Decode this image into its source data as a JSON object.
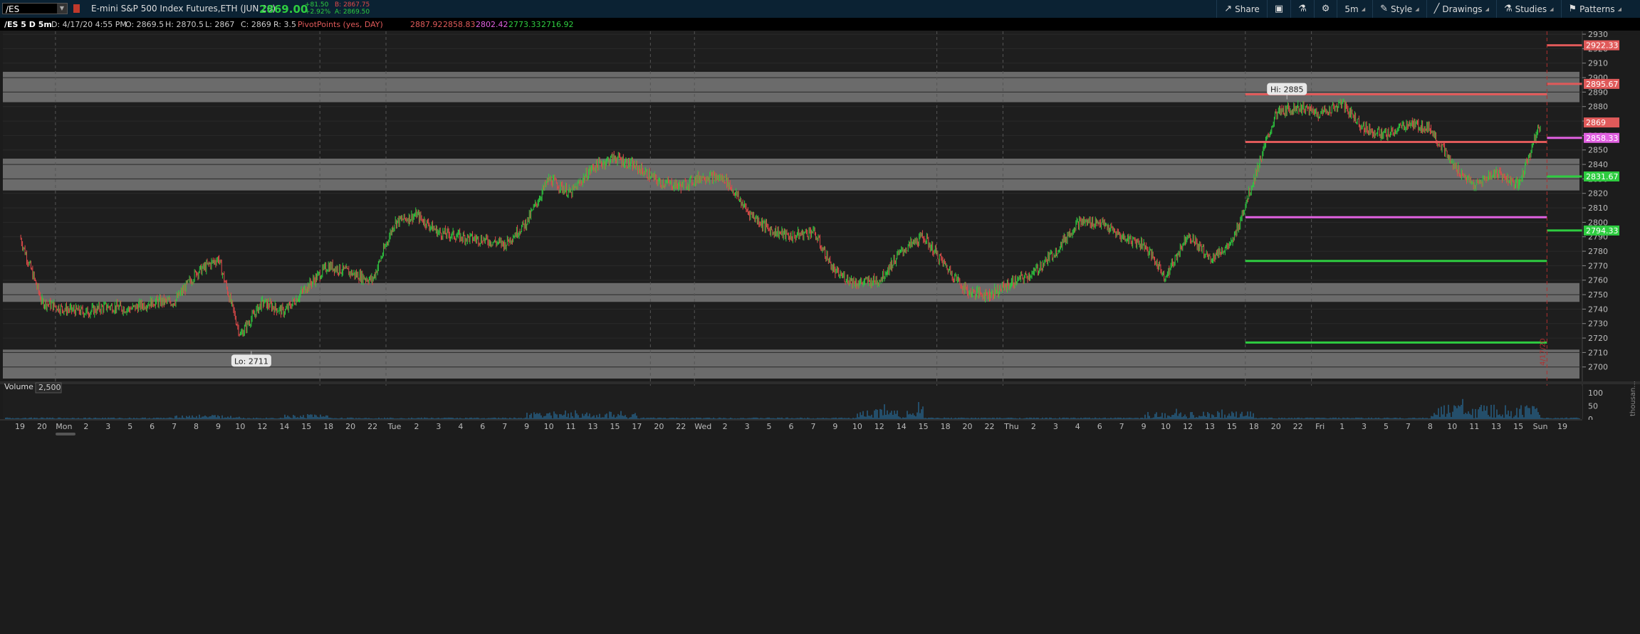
{
  "toolbar": {
    "symbol": "/ES",
    "description": "E-mini S&P 500 Index Futures,ETH (JUN 20)",
    "last_price": "2869.00",
    "change_abs": "+81.50",
    "change_pct": "+2.92%",
    "bid": "B: 2867.75",
    "ask": "A: 2869.50",
    "share_label": "Share",
    "timeframe_label": "5m",
    "style_label": "Style",
    "drawings_label": "Drawings",
    "studies_label": "Studies",
    "patterns_label": "Patterns",
    "colors": {
      "up": "#2ecc40",
      "down": "#e04a4a",
      "background": "#0b2233"
    }
  },
  "infobar": {
    "title": "/ES 5 D 5m",
    "date": "D: 4/17/20 4:55 PM",
    "open": "O: 2869.5",
    "high": "H: 2870.5",
    "low": "L: 2867",
    "close": "C: 2869",
    "range": "R: 3.5",
    "study_name": "PivotPoints (yes, DAY)",
    "pivot_values": [
      "2887.92",
      "2858.83",
      "2802.42",
      "2773.33",
      "2716.92"
    ],
    "pivot_colors": [
      "#e05a5a",
      "#e05a5a",
      "#e060e0",
      "#2ecc40",
      "#2ecc40"
    ]
  },
  "chart_data": {
    "type": "line",
    "title": "/ES 5 D 5m",
    "y_axis_ticks": [
      2700,
      2710,
      2720,
      2730,
      2740,
      2750,
      2760,
      2770,
      2780,
      2790,
      2800,
      2810,
      2820,
      2830,
      2840,
      2850,
      2860,
      2870,
      2880,
      2890,
      2900,
      2910,
      2920,
      2930
    ],
    "ylim": [
      2692,
      2932
    ],
    "x_axis_ticks": [
      {
        "label": "19",
        "idx": 0
      },
      {
        "label": "20",
        "idx": 1
      },
      {
        "label": "Mon",
        "idx": 2
      },
      {
        "label": "2",
        "idx": 3
      },
      {
        "label": "3",
        "idx": 4
      },
      {
        "label": "5",
        "idx": 5
      },
      {
        "label": "6",
        "idx": 6
      },
      {
        "label": "7",
        "idx": 7
      },
      {
        "label": "8",
        "idx": 8
      },
      {
        "label": "9",
        "idx": 9
      },
      {
        "label": "10",
        "idx": 10
      },
      {
        "label": "12",
        "idx": 11
      },
      {
        "label": "14",
        "idx": 12
      },
      {
        "label": "15",
        "idx": 13
      },
      {
        "label": "18",
        "idx": 14
      },
      {
        "label": "20",
        "idx": 15
      },
      {
        "label": "22",
        "idx": 16
      },
      {
        "label": "Tue",
        "idx": 17
      },
      {
        "label": "2",
        "idx": 18
      },
      {
        "label": "3",
        "idx": 19
      },
      {
        "label": "4",
        "idx": 20
      },
      {
        "label": "6",
        "idx": 21
      },
      {
        "label": "7",
        "idx": 22
      },
      {
        "label": "9",
        "idx": 23
      },
      {
        "label": "10",
        "idx": 24
      },
      {
        "label": "11",
        "idx": 25
      },
      {
        "label": "13",
        "idx": 26
      },
      {
        "label": "15",
        "idx": 27
      },
      {
        "label": "17",
        "idx": 28
      },
      {
        "label": "20",
        "idx": 29
      },
      {
        "label": "22",
        "idx": 30
      },
      {
        "label": "Wed",
        "idx": 31
      },
      {
        "label": "2",
        "idx": 32
      },
      {
        "label": "3",
        "idx": 33
      },
      {
        "label": "5",
        "idx": 34
      },
      {
        "label": "6",
        "idx": 35
      },
      {
        "label": "7",
        "idx": 36
      },
      {
        "label": "9",
        "idx": 37
      },
      {
        "label": "10",
        "idx": 38
      },
      {
        "label": "12",
        "idx": 39
      },
      {
        "label": "14",
        "idx": 40
      },
      {
        "label": "15",
        "idx": 41
      },
      {
        "label": "18",
        "idx": 42
      },
      {
        "label": "20",
        "idx": 43
      },
      {
        "label": "22",
        "idx": 44
      },
      {
        "label": "Thu",
        "idx": 45
      },
      {
        "label": "2",
        "idx": 46
      },
      {
        "label": "3",
        "idx": 47
      },
      {
        "label": "4",
        "idx": 48
      },
      {
        "label": "6",
        "idx": 49
      },
      {
        "label": "7",
        "idx": 50
      },
      {
        "label": "9",
        "idx": 51
      },
      {
        "label": "10",
        "idx": 52
      },
      {
        "label": "12",
        "idx": 53
      },
      {
        "label": "13",
        "idx": 54
      },
      {
        "label": "15",
        "idx": 55
      },
      {
        "label": "18",
        "idx": 56
      },
      {
        "label": "20",
        "idx": 57
      },
      {
        "label": "22",
        "idx": 58
      },
      {
        "label": "Fri",
        "idx": 59
      },
      {
        "label": "1",
        "idx": 60
      },
      {
        "label": "3",
        "idx": 61
      },
      {
        "label": "5",
        "idx": 62
      },
      {
        "label": "7",
        "idx": 63
      },
      {
        "label": "8",
        "idx": 64
      },
      {
        "label": "10",
        "idx": 65
      },
      {
        "label": "11",
        "idx": 66
      },
      {
        "label": "13",
        "idx": 67
      },
      {
        "label": "15",
        "idx": 68
      },
      {
        "label": "Sun",
        "idx": 69
      },
      {
        "label": "19",
        "idx": 70
      }
    ],
    "price_path": [
      [
        0,
        2790
      ],
      [
        1,
        2745
      ],
      [
        2,
        2740
      ],
      [
        3,
        2738
      ],
      [
        4,
        2742
      ],
      [
        5,
        2740
      ],
      [
        6,
        2745
      ],
      [
        7,
        2745
      ],
      [
        8,
        2765
      ],
      [
        9,
        2775
      ],
      [
        10,
        2722
      ],
      [
        11,
        2745
      ],
      [
        12,
        2738
      ],
      [
        13,
        2755
      ],
      [
        14,
        2770
      ],
      [
        15,
        2765
      ],
      [
        16,
        2760
      ],
      [
        17,
        2800
      ],
      [
        18,
        2805
      ],
      [
        19,
        2793
      ],
      [
        20,
        2790
      ],
      [
        21,
        2788
      ],
      [
        22,
        2785
      ],
      [
        23,
        2800
      ],
      [
        24,
        2830
      ],
      [
        25,
        2820
      ],
      [
        26,
        2838
      ],
      [
        27,
        2845
      ],
      [
        28,
        2838
      ],
      [
        29,
        2828
      ],
      [
        30,
        2825
      ],
      [
        31,
        2832
      ],
      [
        32,
        2830
      ],
      [
        33,
        2808
      ],
      [
        34,
        2795
      ],
      [
        35,
        2790
      ],
      [
        36,
        2794
      ],
      [
        37,
        2765
      ],
      [
        38,
        2758
      ],
      [
        39,
        2760
      ],
      [
        40,
        2780
      ],
      [
        41,
        2790
      ],
      [
        42,
        2770
      ],
      [
        43,
        2752
      ],
      [
        44,
        2750
      ],
      [
        45,
        2758
      ],
      [
        46,
        2765
      ],
      [
        47,
        2780
      ],
      [
        48,
        2800
      ],
      [
        49,
        2800
      ],
      [
        50,
        2790
      ],
      [
        51,
        2785
      ],
      [
        52,
        2762
      ],
      [
        53,
        2792
      ],
      [
        54,
        2775
      ],
      [
        55,
        2785
      ],
      [
        56,
        2830
      ],
      [
        57,
        2875
      ],
      [
        58,
        2880
      ],
      [
        59,
        2875
      ],
      [
        60,
        2882
      ],
      [
        61,
        2865
      ],
      [
        62,
        2860
      ],
      [
        63,
        2868
      ],
      [
        64,
        2865
      ],
      [
        65,
        2840
      ],
      [
        66,
        2825
      ],
      [
        67,
        2835
      ],
      [
        68,
        2825
      ],
      [
        69,
        2868
      ]
    ],
    "zones": [
      [
        2883,
        2904
      ],
      [
        2822,
        2844
      ],
      [
        2745,
        2758
      ],
      [
        2692,
        2712
      ]
    ],
    "pivot_lines_yesterday": [
      {
        "value": 2888.5,
        "color": "#e05a5a"
      },
      {
        "value": 2855.5,
        "color": "#e05a5a"
      },
      {
        "value": 2803.5,
        "color": "#e060e0"
      },
      {
        "value": 2773.3,
        "color": "#2ecc40"
      },
      {
        "value": 2716.9,
        "color": "#2ecc40"
      }
    ],
    "pivot_lines_next": [
      {
        "value": 2922.33,
        "color": "#e05a5a"
      },
      {
        "value": 2895.67,
        "color": "#e05a5a"
      },
      {
        "value": 2858.33,
        "color": "#e060e0"
      },
      {
        "value": 2831.67,
        "color": "#2ecc40"
      },
      {
        "value": 2794.33,
        "color": "#2ecc40"
      }
    ],
    "price_labels": [
      {
        "text": "2922.33",
        "value": 2922.33,
        "color": "#e05a5a"
      },
      {
        "text": "2895.67",
        "value": 2895.67,
        "color": "#e05a5a"
      },
      {
        "text": "2869",
        "value": 2869,
        "color": "#e05a5a"
      },
      {
        "text": "2858.33",
        "value": 2858.33,
        "color": "#e060e0"
      },
      {
        "text": "2831.67",
        "value": 2831.67,
        "color": "#2ecc40"
      },
      {
        "text": "2794.33",
        "value": 2794.33,
        "color": "#2ecc40"
      }
    ],
    "annotations": [
      {
        "text": "Hi: 2885",
        "value": 2885,
        "idx": 57.5
      },
      {
        "text": "Lo: 2711",
        "value": 2711,
        "idx": 10.5
      }
    ],
    "date_marker": {
      "text": "4/17/20",
      "idx": 69.3
    },
    "day_separators": [
      2,
      14,
      17,
      29,
      31,
      42,
      45,
      56,
      59
    ],
    "volume": {
      "label": "Volume",
      "scale_label": "2,500",
      "y_ticks": [
        0,
        50,
        100
      ],
      "unit_label": "thousan...",
      "bursts": [
        [
          7,
          10,
          30
        ],
        [
          12,
          14,
          35
        ],
        [
          23,
          28,
          55
        ],
        [
          38,
          41,
          70
        ],
        [
          51,
          56,
          55
        ],
        [
          64,
          69,
          100
        ]
      ]
    }
  }
}
